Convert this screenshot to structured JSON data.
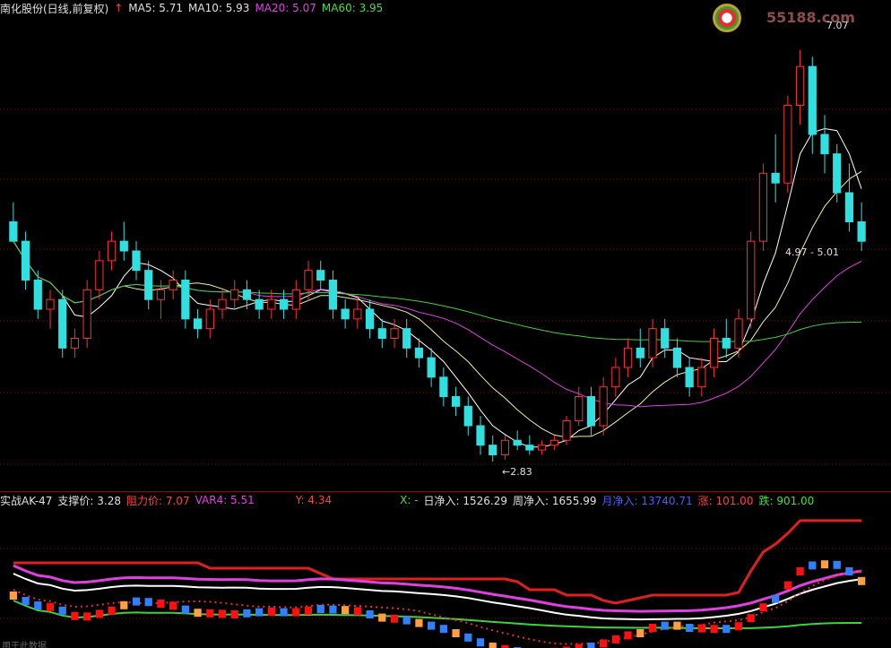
{
  "main_header": {
    "stock": "南化股份(日线,前复权)",
    "ma5": "MA5: 5.71",
    "ma10": "MA10: 5.93",
    "ma20": "MA20: 5.07",
    "ma60": "MA60: 3.95"
  },
  "indicator_header": {
    "name": "实战AK-47",
    "support": "支撑价: 3.28",
    "resistance": "阻力价: 7.07",
    "var4": "VAR4: 5.51",
    "y": "Y: 4.34",
    "x": "X: -",
    "daily_net": "日净入: 1526.29",
    "weekly_net": "周净入: 1655.99",
    "monthly_net": "月净入: 13740.71",
    "up": "涨: 101.00",
    "down": "跌: 901.00"
  },
  "annotations": {
    "high": "7.07",
    "low": "2.83",
    "range": "4.97 - 5.01"
  },
  "logo": {
    "text": "55188.com"
  },
  "footer": {
    "text": "用于此数据"
  },
  "colors": {
    "up_candle": "#ff3030",
    "down_candle": "#30e0e0",
    "ma5": "#ffffff",
    "ma10": "#f0f0a0",
    "ma20": "#e040e0",
    "ma60": "#40d040"
  },
  "chart_data": {
    "type": "candlestick",
    "title": "南化股份(日线,前复权)",
    "ohlc": [
      [
        5.3,
        5.5,
        5.2,
        5.1
      ],
      [
        5.1,
        5.2,
        4.6,
        4.7
      ],
      [
        4.7,
        4.8,
        4.3,
        4.4
      ],
      [
        4.4,
        4.6,
        4.2,
        4.5
      ],
      [
        4.5,
        4.6,
        3.9,
        4.0
      ],
      [
        4.0,
        4.2,
        3.9,
        4.1
      ],
      [
        4.1,
        4.7,
        4.0,
        4.6
      ],
      [
        4.6,
        5.0,
        4.5,
        4.9
      ],
      [
        4.9,
        5.2,
        4.8,
        5.1
      ],
      [
        5.1,
        5.3,
        4.9,
        5.0
      ],
      [
        5.0,
        5.1,
        4.7,
        4.8
      ],
      [
        4.8,
        4.9,
        4.4,
        4.5
      ],
      [
        4.5,
        4.7,
        4.3,
        4.6
      ],
      [
        4.6,
        4.8,
        4.5,
        4.7
      ],
      [
        4.7,
        4.8,
        4.2,
        4.3
      ],
      [
        4.3,
        4.4,
        4.1,
        4.2
      ],
      [
        4.2,
        4.5,
        4.1,
        4.4
      ],
      [
        4.4,
        4.6,
        4.3,
        4.5
      ],
      [
        4.5,
        4.7,
        4.4,
        4.6
      ],
      [
        4.6,
        4.7,
        4.4,
        4.5
      ],
      [
        4.5,
        4.6,
        4.3,
        4.4
      ],
      [
        4.4,
        4.6,
        4.3,
        4.5
      ],
      [
        4.5,
        4.6,
        4.3,
        4.4
      ],
      [
        4.4,
        4.7,
        4.3,
        4.6
      ],
      [
        4.6,
        4.9,
        4.5,
        4.8
      ],
      [
        4.8,
        4.9,
        4.6,
        4.7
      ],
      [
        4.7,
        4.8,
        4.3,
        4.4
      ],
      [
        4.4,
        4.5,
        4.2,
        4.3
      ],
      [
        4.3,
        4.5,
        4.2,
        4.4
      ],
      [
        4.4,
        4.5,
        4.1,
        4.2
      ],
      [
        4.2,
        4.3,
        4.0,
        4.1
      ],
      [
        4.1,
        4.3,
        4.0,
        4.2
      ],
      [
        4.2,
        4.3,
        3.9,
        4.0
      ],
      [
        4.0,
        4.1,
        3.8,
        3.9
      ],
      [
        3.9,
        4.0,
        3.6,
        3.7
      ],
      [
        3.7,
        3.8,
        3.4,
        3.5
      ],
      [
        3.5,
        3.6,
        3.3,
        3.4
      ],
      [
        3.4,
        3.5,
        3.1,
        3.2
      ],
      [
        3.2,
        3.3,
        2.9,
        3.0
      ],
      [
        3.0,
        3.1,
        2.83,
        2.9
      ],
      [
        2.9,
        3.1,
        2.85,
        3.05
      ],
      [
        3.05,
        3.15,
        2.95,
        3.0
      ],
      [
        3.0,
        3.1,
        2.9,
        2.95
      ],
      [
        2.95,
        3.05,
        2.9,
        3.0
      ],
      [
        3.0,
        3.1,
        2.95,
        3.05
      ],
      [
        3.05,
        3.3,
        3.0,
        3.25
      ],
      [
        3.25,
        3.6,
        3.2,
        3.5
      ],
      [
        3.5,
        3.6,
        3.1,
        3.2
      ],
      [
        3.2,
        3.7,
        3.1,
        3.6
      ],
      [
        3.6,
        3.9,
        3.5,
        3.8
      ],
      [
        3.8,
        4.1,
        3.7,
        4.0
      ],
      [
        4.0,
        4.2,
        3.8,
        3.9
      ],
      [
        3.9,
        4.3,
        3.8,
        4.2
      ],
      [
        4.2,
        4.3,
        3.9,
        4.0
      ],
      [
        4.0,
        4.1,
        3.7,
        3.8
      ],
      [
        3.8,
        3.9,
        3.5,
        3.6
      ],
      [
        3.6,
        3.9,
        3.5,
        3.8
      ],
      [
        3.8,
        4.2,
        3.7,
        4.1
      ],
      [
        4.1,
        4.3,
        3.9,
        4.0
      ],
      [
        4.0,
        4.4,
        3.9,
        4.3
      ],
      [
        4.3,
        5.2,
        4.2,
        5.1
      ],
      [
        5.1,
        5.9,
        5.0,
        5.8
      ],
      [
        5.8,
        6.2,
        5.5,
        5.7
      ],
      [
        5.7,
        6.6,
        5.6,
        6.5
      ],
      [
        6.5,
        7.07,
        6.3,
        6.9
      ],
      [
        6.9,
        7.0,
        6.0,
        6.2
      ],
      [
        6.2,
        6.4,
        5.8,
        6.0
      ],
      [
        6.0,
        6.1,
        5.5,
        5.6
      ],
      [
        5.6,
        5.9,
        5.2,
        5.3
      ],
      [
        5.3,
        5.5,
        5.0,
        5.1
      ]
    ],
    "x_range": [
      0,
      70
    ],
    "y_range": [
      2.6,
      7.4
    ]
  }
}
